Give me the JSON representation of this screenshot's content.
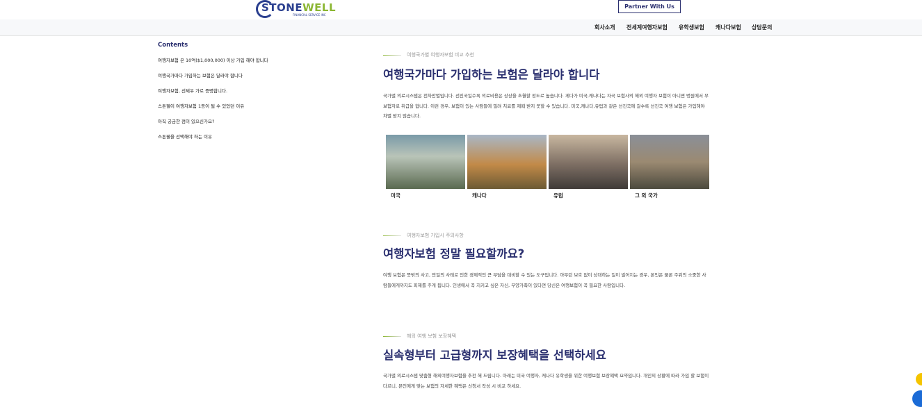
{
  "header": {
    "logo_text_a": "STONE",
    "logo_text_b": "WELL",
    "logo_sub": "FINANCIAL SERVICE INC",
    "partner_button": "Partner With Us"
  },
  "nav": {
    "items": [
      "회사소개",
      "전세계여행자보험",
      "유학생보험",
      "캐나다보험",
      "상담문의"
    ]
  },
  "sidebar": {
    "title": "Contents",
    "items": [
      "여행자보험 은 10억($1,000,000) 이상 가입 해야 합니다",
      "여행국가마다 가입하는 보험은 달라야 합니다",
      "여행자보험, 선체우 가로 증명합니다.",
      "스톤웰이 여행자보험 1등이 될 수 있었던 이유",
      "아직 궁금한 점이 있으신가요?",
      "스톤웰을 선택해야 하는 이유"
    ]
  },
  "section1": {
    "tag": "여행국가별 여행자보험 비교 추천",
    "title": "여행국가마다 가입하는 보험은 달라야 합니다",
    "body": "국가별 의료시스템은 천차만별입니다. 선진국일수록 의료비용은 상상을 초월할 정도로 높습니다. 게다가 미국,캐나다는 자국 보험사의 해외 여행자 보험이 아니면 병원에서 무보험자로 취급을 합니다. 이런 경우, 보험이 있는 사람들에 밀려 치료를 제때 받지 못할 수 있습니다. 미국,캐나다,유럽과 같은 선진국에 갈수록 선진국 여행 보험은 가입해야 차별 받지 않습니다.",
    "photos": [
      {
        "label": "미국",
        "icon": "usa-photo"
      },
      {
        "label": "캐나다",
        "icon": "canada-photo"
      },
      {
        "label": "유럽",
        "icon": "europe-photo"
      },
      {
        "label": "그 외 국가",
        "icon": "other-countries-photo"
      }
    ]
  },
  "section2": {
    "tag": "여행자보험 가입시 주의사항",
    "title": "여행자보험 정말 필요할까요?",
    "body": "여행 보험은 뜻밖의 사고, 만일의 사태로 인한 경제적인 큰 부담을 대비할 수 있는 도구입니다. 아무런 보호 없이 상대하는 일이 벌어지는 경우, 본인은 물론 주위의 소중한 사람들에게까지도 피해를 주게 됩니다. 인생에서 꼭 지키고 싶은 자신, 부양가족이 있다면 당신은 여행보험이 꼭 필요한 사람입니다."
  },
  "section3": {
    "tag": "해외 여행 보험 보장혜택",
    "title": "실속형부터 고급형까지 보장혜택을 선택하세요",
    "body": "국가별 의료시스템 맞춤형 해외여행자보험을 추천 해 드립니다. 아래는 미국 여행자, 캐나다 유학생을 위한 여행보험 보장혜택 요약입니다. 개인의 상황에 따라 가입 할 보험이 다르니, 본인에게 맞는 보험의 자세한 혜택은 신청서 작성 시 비교 하세요."
  },
  "colors": {
    "brand_navy": "#2a2f6f",
    "brand_green": "#8bb632"
  }
}
